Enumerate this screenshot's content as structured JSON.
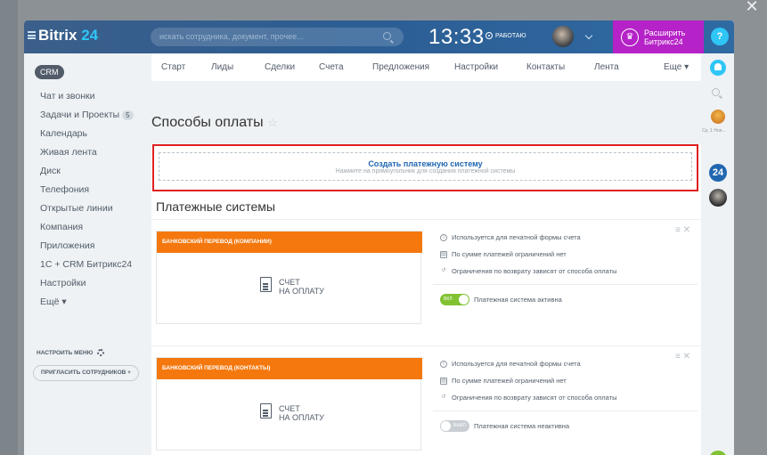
{
  "close": "✕",
  "header": {
    "logo_main": "Bitrix",
    "logo_num": "24",
    "search_placeholder": "искать сотрудника, документ, прочее...",
    "time": "13:33",
    "status": "РАБОТАЮ",
    "upgrade_line1": "Расширить",
    "upgrade_line2": "Битрикс24",
    "help": "?"
  },
  "sidebar": {
    "crm": "CRM",
    "items": [
      "Чат и звонки",
      "Задачи и Проекты",
      "Календарь",
      "Живая лента",
      "Диск",
      "Телефония",
      "Открытые линии",
      "Компания",
      "Приложения",
      "1С + CRM Битрикс24",
      "Настройки",
      "Ещё ▾"
    ],
    "tasks_badge": "5",
    "configure_menu": "НАСТРОИТЬ МЕНЮ",
    "invite": "ПРИГЛАСИТЬ СОТРУДНИКОВ  +"
  },
  "tabs": [
    "Старт",
    "Лиды",
    "Сделки",
    "Счета",
    "Предложения",
    "Настройки",
    "Контакты",
    "Лента",
    "Еще ▾"
  ],
  "page_title": "Способы оплаты",
  "create": {
    "title": "Создать платежную систему",
    "subtitle": "Нажмите на прямоугольник для создания платежной системы"
  },
  "section_title": "Платежные системы",
  "payment_systems": [
    {
      "name": "БАНКОВСКИЙ ПЕРЕВОД (КОМПАНИИ)",
      "doc_line1": "СЧЕТ",
      "doc_line2": "НА ОПЛАТУ",
      "info": [
        "Используется для печатной формы счета",
        "По сумме платежей ограничений нет",
        "Ограничения по возврату зависят от способа оплаты"
      ],
      "toggle": "ВКЛ",
      "toggle_on": true,
      "status": "Платежная система активна"
    },
    {
      "name": "БАНКОВСКИЙ ПЕРЕВОД (КОНТАКТЫ)",
      "doc_line1": "СЧЕТ",
      "doc_line2": "НА ОПЛАТУ",
      "info": [
        "Используется для печатной формы счета",
        "По сумме платежей ограничений нет",
        "Ограничения по возврату зависят от способа оплаты"
      ],
      "toggle": "ВЫКЛ",
      "toggle_on": false,
      "status": "Платежная система неактивна"
    }
  ],
  "right_panel": {
    "user_note": "Ср, 1 Ноя...",
    "badge_24": "24"
  },
  "icons": [
    "hamburger-icon",
    "search-icon",
    "clock-status-icon",
    "crown-icon",
    "help-icon",
    "gear-icon",
    "star-icon",
    "document-icon",
    "info-icon",
    "sum-icon",
    "return-icon",
    "menu-icon",
    "close-icon",
    "bell-icon",
    "phone-icon"
  ],
  "colors": {
    "header_blue": "#2c5d93",
    "accent_orange": "#f4780e",
    "upgrade_purple": "#b522c7",
    "active_green": "#81c233",
    "highlight_red": "#e02020"
  }
}
